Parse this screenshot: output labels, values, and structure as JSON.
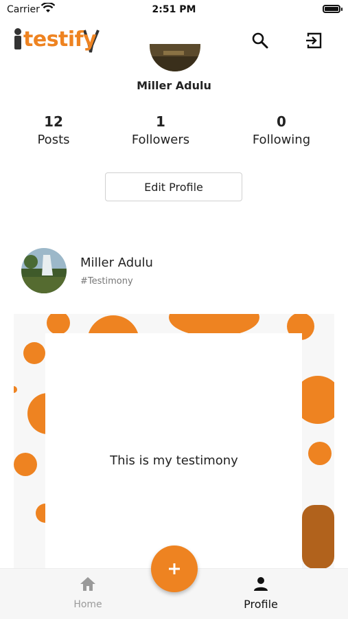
{
  "status_bar": {
    "carrier": "Carrier",
    "time": "2:51 PM"
  },
  "app_bar": {
    "logo_text": "testify",
    "search_icon": "search-icon",
    "logout_icon": "logout-icon"
  },
  "profile": {
    "name": "Miller Adulu",
    "stats": [
      {
        "value": "12",
        "label": "Posts"
      },
      {
        "value": "1",
        "label": "Followers"
      },
      {
        "value": "0",
        "label": "Following"
      }
    ],
    "edit_button": "Edit Profile"
  },
  "post": {
    "author": "Miller Adulu",
    "tag": "#Testimony",
    "text": "This is my testimony"
  },
  "bottom_nav": {
    "fab_icon": "plus-icon",
    "items": [
      {
        "label": "Home",
        "icon": "home-icon",
        "active": false
      },
      {
        "label": "Profile",
        "icon": "person-icon",
        "active": true
      }
    ]
  },
  "colors": {
    "accent": "#ee8321",
    "inactive": "#9a9a9a",
    "active": "#111111"
  }
}
